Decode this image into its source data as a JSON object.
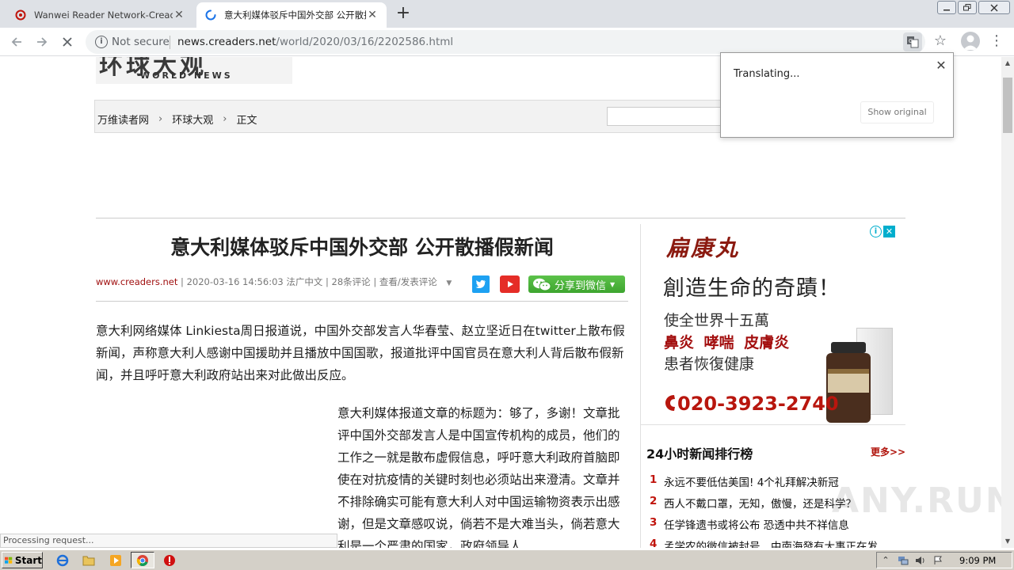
{
  "browser": {
    "tabs": [
      {
        "title": "Wanwei Reader Network-Creaders.N",
        "active": false
      },
      {
        "title": "意大利媒体驳斥中国外交部 公开散播",
        "active": true
      }
    ],
    "address": {
      "security_label": "Not secure",
      "url_host": "news.creaders.net",
      "url_path": "/world/2020/03/16/2202586.html"
    },
    "page_loading": true
  },
  "translate_bubble": {
    "status": "Translating...",
    "show_original_label": "Show original"
  },
  "site": {
    "logo_text": "环球大观",
    "logo_subtitle": "WORLD NEWS",
    "breadcrumb": [
      "万维读者网",
      "环球大观",
      "正文"
    ]
  },
  "article": {
    "title": "意大利媒体驳斥中国外交部 公开散播假新闻",
    "meta": {
      "source": "www.creaders.net",
      "datetime": "2020-03-16 14:56:03",
      "category": "法广中文",
      "comments": "28条评论",
      "comment_link": "查看/发表评论",
      "wechat_share": "分享到微信"
    },
    "paragraphs": [
      "意大利网络媒体 Linkiesta周日报道说，中国外交部发言人华春莹、赵立坚近日在twitter上散布假新闻，声称意大利人感谢中国援助并且播放中国国歌，报道批评中国官员在意大利人背后散布假新闻，并且呼吁意大利政府站出来对此做出反应。",
      "意大利媒体报道文章的标题为：够了，多谢！文章批评中国外交部发言人是中国宣传机构的成员，他们的工作之一就是散布虚假信息，呼吁意大利政府首脑即使在对抗疫情的关键时刻也必须站出来澄清。文章并不排除确实可能有意大利人对中国运输物资表示出感谢，但是文章感叹说，倘若不是大难当头，倘若意大利是一个严肃的国家，政府领导人"
    ]
  },
  "ad": {
    "brand": "扁康丸",
    "headline": "創造生命的奇蹟！",
    "line2": "使全世界十五萬",
    "line3": "鼻炎 哮喘 皮膚炎",
    "line4": "患者恢復健康",
    "phone": "020-3923-2740"
  },
  "ranking": {
    "title": "24小时新闻排行榜",
    "more_label": "更多>>",
    "items": [
      {
        "rank": "1",
        "text": "永远不要低估美国! 4个礼拜解决新冠"
      },
      {
        "rank": "2",
        "text": "西人不戴口罩，无知，傲慢，还是科学？"
      },
      {
        "rank": "3",
        "text": "任学锋遗书或将公布 恐透中共不祥信息"
      },
      {
        "rank": "4",
        "text": "孟学农的微信被封号，中南海發有大事正在发"
      }
    ]
  },
  "watermark": "ANY.RUN",
  "status_bar": "Processing request...",
  "taskbar": {
    "start_label": "Start",
    "clock": "9:09 PM"
  },
  "colors": {
    "accent_red": "#c0140c",
    "wechat_green": "#3ea52f",
    "twitter_blue": "#1da1f2",
    "youtube_red": "#e52d27"
  }
}
